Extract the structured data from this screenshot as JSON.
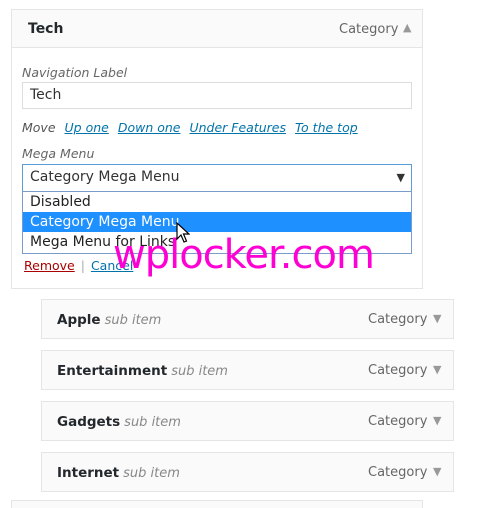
{
  "menu_item": {
    "title": "Tech",
    "type": "Category",
    "nav_label_caption": "Navigation Label",
    "nav_label_value": "Tech",
    "move_caption": "Move",
    "move_links": [
      "Up one",
      "Down one",
      "Under Features",
      "To the top"
    ],
    "mega_caption": "Mega Menu",
    "mega_selected": "Category Mega Menu",
    "mega_options": [
      "Disabled",
      "Category Mega Menu",
      "Mega Menu for Links"
    ],
    "remove_label": "Remove",
    "separator": "|",
    "cancel_label": "Cancel"
  },
  "sub_items": [
    {
      "title": "Apple",
      "note": "sub item",
      "type": "Category"
    },
    {
      "title": "Entertainment",
      "note": "sub item",
      "type": "Category"
    },
    {
      "title": "Gadgets",
      "note": "sub item",
      "type": "Category"
    },
    {
      "title": "Internet",
      "note": "sub item",
      "type": "Category"
    }
  ],
  "watermark": "wplocker.com",
  "colors": {
    "link": "#0073aa",
    "remove": "#aa0000",
    "selected_option": "#1e90ff",
    "watermark": "#ff00d4"
  }
}
